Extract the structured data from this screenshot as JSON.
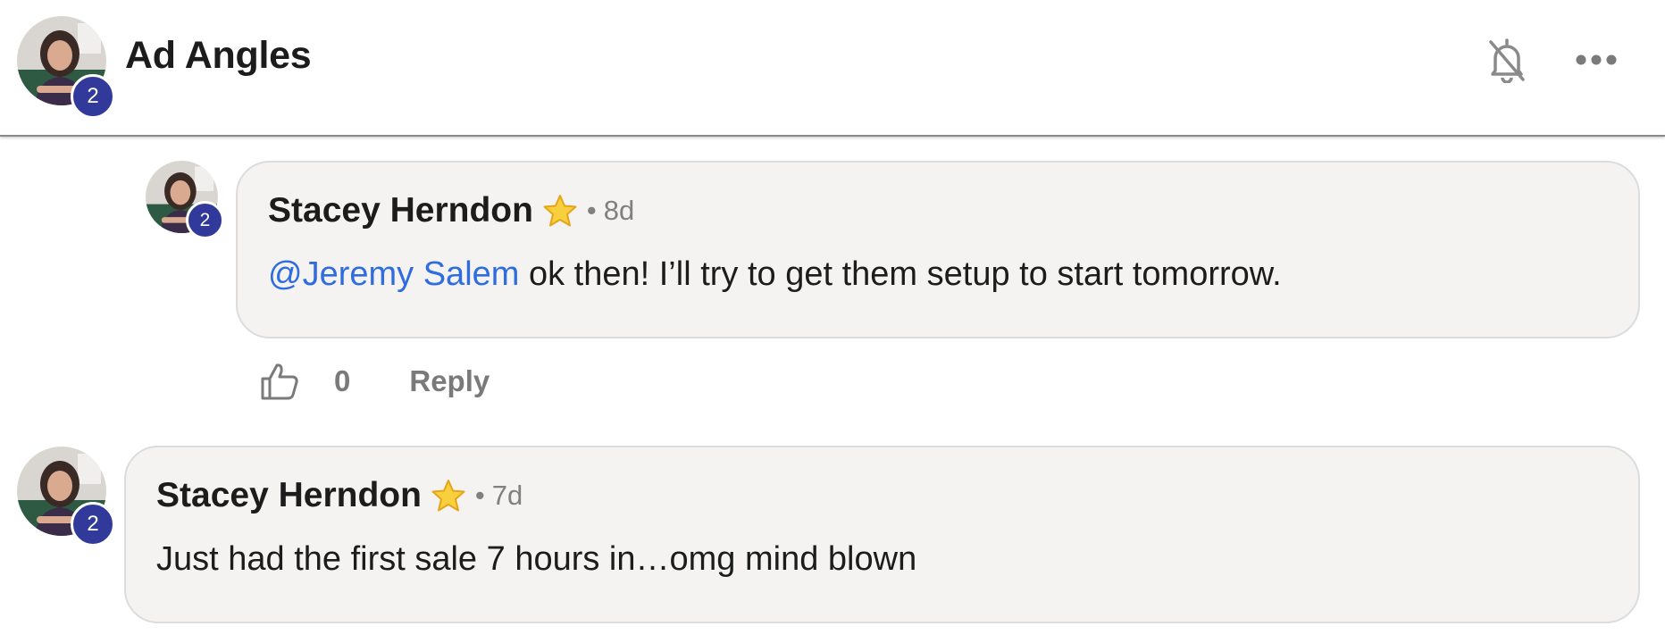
{
  "header": {
    "title": "Ad Angles",
    "avatar_badge": "2",
    "icons": {
      "notifications": "bell-off-icon",
      "more": "more-horizontal-icon"
    }
  },
  "comments": [
    {
      "author": "Stacey Herndon",
      "badge_level": "2",
      "star_icon": "star-icon",
      "separator": "•",
      "age": "8d",
      "mention": "@Jeremy Salem",
      "text": " ok then! I’ll try to get them setup to start tomorrow.",
      "likes": "0",
      "reply_label": "Reply"
    },
    {
      "author": "Stacey Herndon",
      "badge_level": "2",
      "star_icon": "star-icon",
      "separator": "•",
      "age": "7d",
      "text": "Just had the first sale 7 hours in…omg mind blown"
    }
  ],
  "colors": {
    "badge": "#31399a",
    "mention": "#2f6ce0",
    "bubble_bg": "#f4f3f1",
    "muted_text": "#7a7a7a"
  }
}
